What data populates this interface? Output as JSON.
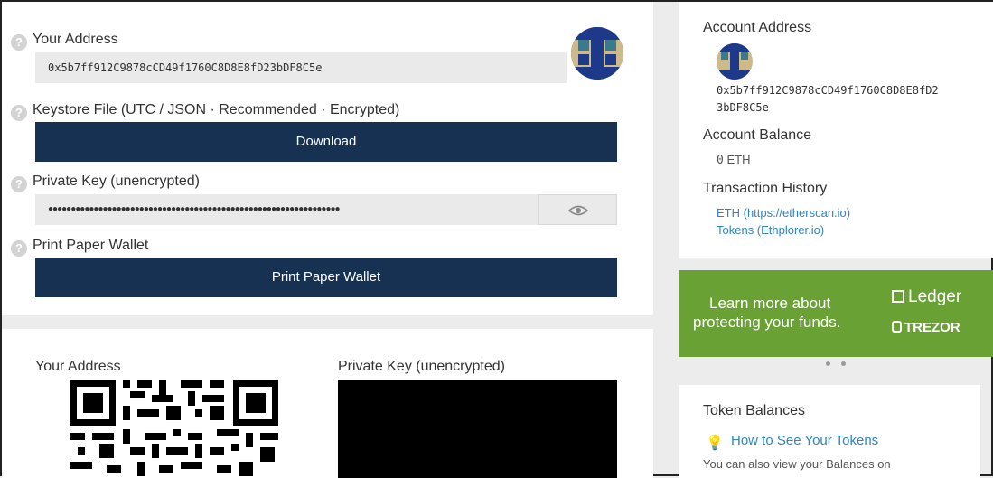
{
  "wallet": {
    "address_label": "Your Address",
    "address": "0x5b7ff912C9878cCD49f1760C8D8E8fD23bDF8C5e",
    "keystore_label": "Keystore File (UTC / JSON · Recommended · Encrypted)",
    "download_label": "Download",
    "private_key_label": "Private Key (unencrypted)",
    "private_key_masked": "●●●●●●●●●●●●●●●●●●●●●●●●●●●●●●●●●●●●●●●●●●●●●●●●●●●●●●●●●●●●●●●●",
    "paper_wallet_label": "Print Paper Wallet",
    "print_button_label": "Print Paper Wallet",
    "help_glyph": "?"
  },
  "qr_section": {
    "address_label": "Your Address",
    "private_key_label": "Private Key (unencrypted)"
  },
  "sidebar": {
    "account_address_label": "Account Address",
    "address_line1": "0x5b7ff912C9878cCD49f1760C8D8E8fD2",
    "address_line2": "3bDF8C5e",
    "balance_label": "Account Balance",
    "balance_value": "0",
    "balance_unit": "ETH",
    "history_label": "Transaction History",
    "history_links": [
      "ETH (https://etherscan.io)",
      "Tokens (Ethplorer.io)"
    ]
  },
  "promo": {
    "text_line1": "Learn more about",
    "text_line2": "protecting your funds.",
    "brand1": "Ledger",
    "brand2": "TREZOR",
    "color": "#6aa135"
  },
  "tokens": {
    "title": "Token Balances",
    "how_to_link": "How to See Your Tokens",
    "note": "You can also view your Balances on"
  },
  "colors": {
    "button_bg": "#163151",
    "link": "#2e86c1"
  }
}
